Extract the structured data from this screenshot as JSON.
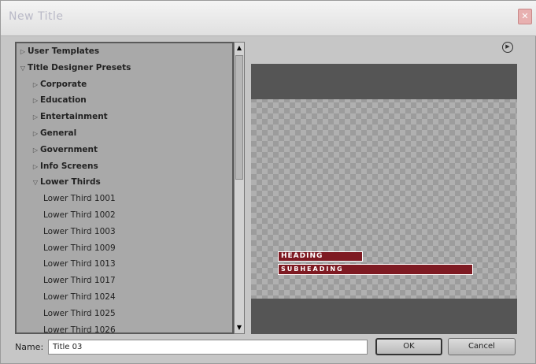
{
  "window": {
    "title": "New Title",
    "close_label": "✕"
  },
  "tree": {
    "items": [
      {
        "label": "User Templates",
        "bold": true,
        "indent": 0,
        "expanded": false
      },
      {
        "label": "Title Designer Presets",
        "bold": true,
        "indent": 0,
        "expanded": true
      },
      {
        "label": "Corporate",
        "bold": true,
        "indent": 1,
        "expanded": false
      },
      {
        "label": "Education",
        "bold": true,
        "indent": 1,
        "expanded": false
      },
      {
        "label": "Entertainment",
        "bold": true,
        "indent": 1,
        "expanded": false
      },
      {
        "label": "General",
        "bold": true,
        "indent": 1,
        "expanded": false
      },
      {
        "label": "Government",
        "bold": true,
        "indent": 1,
        "expanded": false
      },
      {
        "label": "Info Screens",
        "bold": true,
        "indent": 1,
        "expanded": false
      },
      {
        "label": "Lower Thirds",
        "bold": true,
        "indent": 1,
        "expanded": true
      },
      {
        "label": "Lower Third 1001",
        "bold": false,
        "indent": 2
      },
      {
        "label": "Lower Third 1002",
        "bold": false,
        "indent": 2
      },
      {
        "label": "Lower Third 1003",
        "bold": false,
        "indent": 2
      },
      {
        "label": "Lower Third 1009",
        "bold": false,
        "indent": 2
      },
      {
        "label": "Lower Third 1013",
        "bold": false,
        "indent": 2
      },
      {
        "label": "Lower Third 1017",
        "bold": false,
        "indent": 2
      },
      {
        "label": "Lower Third 1024",
        "bold": false,
        "indent": 2
      },
      {
        "label": "Lower Third 1025",
        "bold": false,
        "indent": 2
      },
      {
        "label": "Lower Third 1026",
        "bold": false,
        "indent": 2
      }
    ]
  },
  "preview": {
    "heading": "HEADING",
    "subheading": "SUBHEADING",
    "accent_color": "#7e1a22",
    "menu_icon": "play-circle-icon"
  },
  "name_field": {
    "label": "Name:",
    "value": "Title 03"
  },
  "buttons": {
    "ok": "OK",
    "cancel": "Cancel"
  },
  "icons": {
    "collapsed": "▷",
    "expanded": "▽",
    "scroll_up": "▲",
    "scroll_down": "▼",
    "menu": "▶"
  }
}
